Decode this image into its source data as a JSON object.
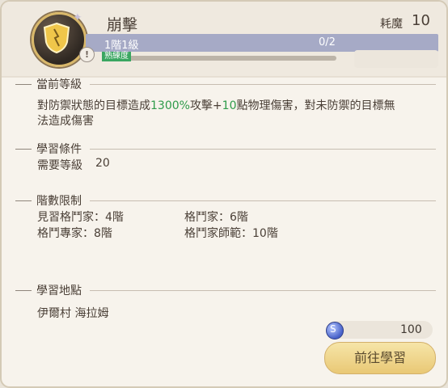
{
  "skill": {
    "name": "崩擊",
    "mana_label": "耗魔",
    "mana_value": "10",
    "rank_label": "1階1級",
    "progress_text": "0/2",
    "proficiency_label": "熟練度"
  },
  "sections": {
    "current_level": {
      "title": "當前等級",
      "desc_1": "對防禦狀態的目標造成",
      "desc_2": "1300%",
      "desc_3": "攻擊+",
      "desc_4": "10",
      "desc_5": "點物理傷害，對未防禦的目標無",
      "desc_6": "法造成傷害"
    },
    "learn_conditions": {
      "title": "學習條件",
      "required_label": "需要等級",
      "required_value": "20"
    },
    "rank_limits": {
      "title": "階數限制",
      "items": [
        "見習格鬥家：4階",
        "格鬥家：6階",
        "格鬥專家：8階",
        "格鬥家師範：10階"
      ]
    },
    "learn_location": {
      "title": "學習地點",
      "value": "伊爾村 海拉姆"
    }
  },
  "cost": {
    "value": "100"
  },
  "go_button_label": "前往學習",
  "colors": {
    "accent_green": "#2e9b4a",
    "bar": "#a6aac6",
    "button": "#e9c875"
  }
}
